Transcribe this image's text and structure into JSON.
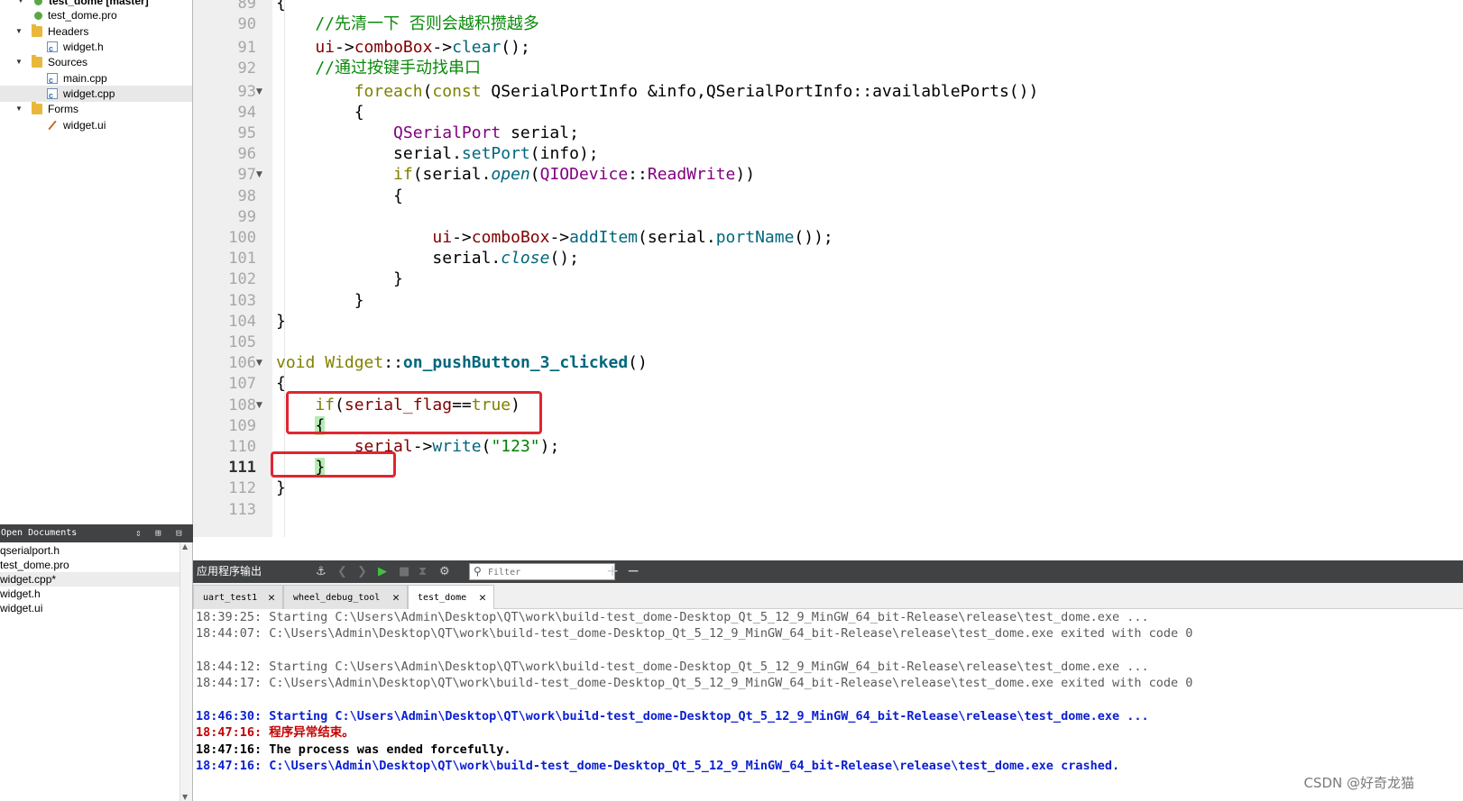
{
  "project_tree": {
    "root": "test_dome [master]",
    "items": [
      {
        "label": "test_dome.pro",
        "type": "pro-file-icon"
      },
      {
        "label": "Headers",
        "type": "folder-icon"
      },
      {
        "label": "widget.h",
        "type": "cpp-header-icon"
      },
      {
        "label": "Sources",
        "type": "folder-icon"
      },
      {
        "label": "main.cpp",
        "type": "cpp-file-icon"
      },
      {
        "label": "widget.cpp",
        "type": "cpp-file-icon"
      },
      {
        "label": "Forms",
        "type": "folder-icon"
      },
      {
        "label": "widget.ui",
        "type": "ui-file-icon"
      }
    ]
  },
  "open_documents": {
    "title": "Open Documents",
    "items": [
      "qserialport.h",
      "test_dome.pro",
      "widget.cpp*",
      "widget.h",
      "widget.ui"
    ]
  },
  "editor": {
    "current_line": "111",
    "lines": [
      {
        "n": "89",
        "text": "{"
      },
      {
        "n": "90",
        "text": "    //先清一下 否则会越积攒越多"
      },
      {
        "n": "91",
        "text": "    ui->comboBox->clear();"
      },
      {
        "n": "92",
        "text": "    //通过按键手动找串口"
      },
      {
        "n": "93",
        "text": "        foreach(const QSerialPortInfo &info,QSerialPortInfo::availablePorts())"
      },
      {
        "n": "94",
        "text": "        {"
      },
      {
        "n": "95",
        "text": "            QSerialPort serial;"
      },
      {
        "n": "96",
        "text": "            serial.setPort(info);"
      },
      {
        "n": "97",
        "text": "            if(serial.open(QIODevice::ReadWrite))"
      },
      {
        "n": "98",
        "text": "            {"
      },
      {
        "n": "99",
        "text": ""
      },
      {
        "n": "100",
        "text": "                ui->comboBox->addItem(serial.portName());"
      },
      {
        "n": "101",
        "text": "                serial.close();"
      },
      {
        "n": "102",
        "text": "            }"
      },
      {
        "n": "103",
        "text": "        }"
      },
      {
        "n": "104",
        "text": "}"
      },
      {
        "n": "105",
        "text": ""
      },
      {
        "n": "106",
        "text": "void Widget::on_pushButton_3_clicked()"
      },
      {
        "n": "107",
        "text": "{"
      },
      {
        "n": "108",
        "text": "    if(serial_flag==true)"
      },
      {
        "n": "109",
        "text": "    {"
      },
      {
        "n": "110",
        "text": "        serial->write(\"123\");"
      },
      {
        "n": "111",
        "text": "    }"
      },
      {
        "n": "112",
        "text": "}"
      },
      {
        "n": "113",
        "text": ""
      }
    ]
  },
  "output_pane": {
    "title": "应用程序输出",
    "filter_placeholder": "Filter",
    "tabs": [
      {
        "label": "uart_test1"
      },
      {
        "label": "wheel_debug_tool"
      },
      {
        "label": "test_dome"
      }
    ],
    "lines": [
      {
        "text": "18:39:25: Starting C:\\Users\\Admin\\Desktop\\QT\\work\\build-test_dome-Desktop_Qt_5_12_9_MinGW_64_bit-Release\\release\\test_dome.exe ...",
        "style": "gray"
      },
      {
        "text": "18:44:07: C:\\Users\\Admin\\Desktop\\QT\\work\\build-test_dome-Desktop_Qt_5_12_9_MinGW_64_bit-Release\\release\\test_dome.exe exited with code 0",
        "style": "gray"
      },
      {
        "text": "",
        "style": "gray"
      },
      {
        "text": "18:44:12: Starting C:\\Users\\Admin\\Desktop\\QT\\work\\build-test_dome-Desktop_Qt_5_12_9_MinGW_64_bit-Release\\release\\test_dome.exe ...",
        "style": "gray"
      },
      {
        "text": "18:44:17: C:\\Users\\Admin\\Desktop\\QT\\work\\build-test_dome-Desktop_Qt_5_12_9_MinGW_64_bit-Release\\release\\test_dome.exe exited with code 0",
        "style": "gray"
      },
      {
        "text": "",
        "style": "gray"
      },
      {
        "text": "18:46:30: Starting C:\\Users\\Admin\\Desktop\\QT\\work\\build-test_dome-Desktop_Qt_5_12_9_MinGW_64_bit-Release\\release\\test_dome.exe ...",
        "style": "blue"
      },
      {
        "text": "18:47:16: 程序异常结束。",
        "style": "red"
      },
      {
        "text": "18:47:16: The process was ended forcefully.",
        "style": "black"
      },
      {
        "text": "18:47:16: C:\\Users\\Admin\\Desktop\\QT\\work\\build-test_dome-Desktop_Qt_5_12_9_MinGW_64_bit-Release\\release\\test_dome.exe crashed.",
        "style": "blue"
      }
    ]
  },
  "watermark": "CSDN @好奇龙猫",
  "colors": {
    "annotation_box": "#e0262f",
    "toolbar_bg": "#404244",
    "gutter_bg": "#efefef",
    "output_blue": "#0b1fd1",
    "output_red": "#c40000"
  }
}
